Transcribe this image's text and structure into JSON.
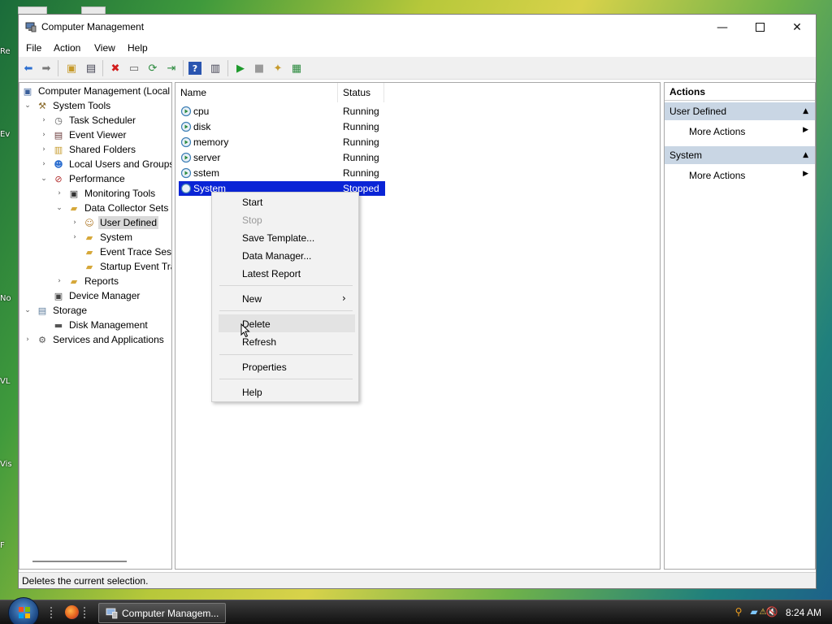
{
  "desktop": {
    "icon_labels": [
      "Re",
      "Ev",
      "No",
      "VL",
      "Vis",
      "F"
    ]
  },
  "window": {
    "title": "Computer Management"
  },
  "menubar": [
    "File",
    "Action",
    "View",
    "Help"
  ],
  "tree": {
    "nodes": [
      {
        "label": "Computer Management (Local",
        "depth": 0,
        "expander": ""
      },
      {
        "label": "System Tools",
        "depth": 1,
        "expander": "down"
      },
      {
        "label": "Task Scheduler",
        "depth": 2,
        "expander": "right"
      },
      {
        "label": "Event Viewer",
        "depth": 2,
        "expander": "right"
      },
      {
        "label": "Shared Folders",
        "depth": 2,
        "expander": "right"
      },
      {
        "label": "Local Users and Groups",
        "depth": 2,
        "expander": "right"
      },
      {
        "label": "Performance",
        "depth": 2,
        "expander": "down"
      },
      {
        "label": "Monitoring Tools",
        "depth": 3,
        "expander": "right"
      },
      {
        "label": "Data Collector Sets",
        "depth": 3,
        "expander": "down"
      },
      {
        "label": "User Defined",
        "depth": 4,
        "expander": "right",
        "selected": true
      },
      {
        "label": "System",
        "depth": 4,
        "expander": "right"
      },
      {
        "label": "Event Trace Sess",
        "depth": 4,
        "expander": ""
      },
      {
        "label": "Startup Event Tra",
        "depth": 4,
        "expander": ""
      },
      {
        "label": "Reports",
        "depth": 3,
        "expander": "right"
      },
      {
        "label": "Device Manager",
        "depth": 2,
        "expander": ""
      },
      {
        "label": "Storage",
        "depth": 1,
        "expander": "down"
      },
      {
        "label": "Disk Management",
        "depth": 2,
        "expander": ""
      },
      {
        "label": "Services and Applications",
        "depth": 1,
        "expander": "right"
      }
    ]
  },
  "list": {
    "columns": [
      "Name",
      "Status"
    ],
    "rows": [
      {
        "name": "cpu",
        "status": "Running"
      },
      {
        "name": "disk",
        "status": "Running"
      },
      {
        "name": "memory",
        "status": "Running"
      },
      {
        "name": "server",
        "status": "Running"
      },
      {
        "name": "sstem",
        "status": "Running"
      },
      {
        "name": "System",
        "status": "Stopped",
        "selected": true
      }
    ]
  },
  "actions": {
    "header": "Actions",
    "sections": [
      {
        "title": "User Defined",
        "item": "More Actions"
      },
      {
        "title": "System",
        "item": "More Actions"
      }
    ]
  },
  "context_menu": {
    "items": [
      {
        "label": "Start",
        "disabled": false
      },
      {
        "label": "Stop",
        "disabled": true
      },
      {
        "label": "Save Template...",
        "disabled": false
      },
      {
        "label": "Data Manager...",
        "disabled": false
      },
      {
        "label": "Latest Report",
        "disabled": false
      },
      {
        "label": "New",
        "disabled": false,
        "submenu": true
      },
      {
        "label": "Delete",
        "disabled": false,
        "hovered": true
      },
      {
        "label": "Refresh",
        "disabled": false
      },
      {
        "label": "Properties",
        "disabled": false
      },
      {
        "label": "Help",
        "disabled": false
      }
    ]
  },
  "status_bar": {
    "text": "Deletes the current selection."
  },
  "taskbar": {
    "button_label": "Computer Managem...",
    "clock": "8:24 AM"
  },
  "colors": {
    "selection": "#0a24d6",
    "action_section": "#c9d6e4"
  }
}
